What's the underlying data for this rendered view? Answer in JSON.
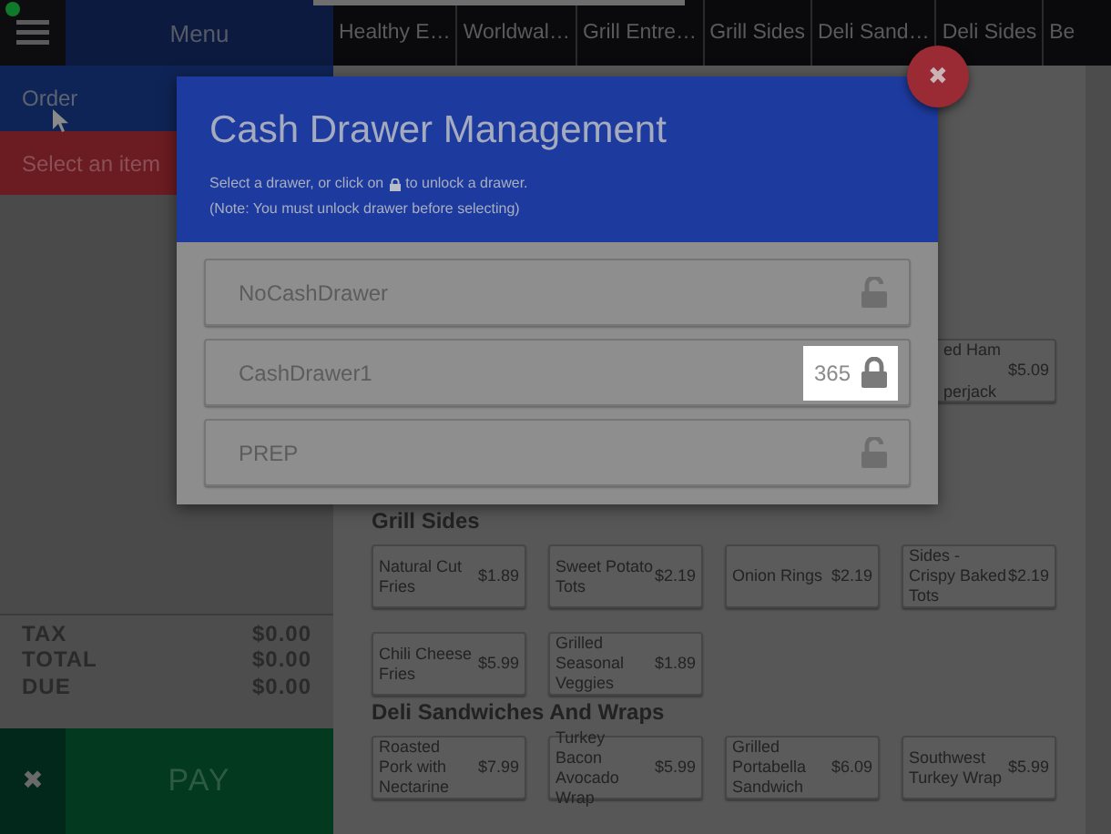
{
  "sidebar": {
    "menu_title": "Menu",
    "order_label": "Order",
    "notice": "Select an item",
    "totals": [
      {
        "label": "TAX",
        "value": "$0.00"
      },
      {
        "label": "TOTAL",
        "value": "$0.00"
      },
      {
        "label": "DUE",
        "value": "$0.00"
      }
    ],
    "pay_label": "PAY",
    "cancel_icon": "✖"
  },
  "tabs": [
    {
      "label": "Healthy E…",
      "selected": false
    },
    {
      "label": "Worldwal…",
      "selected": false
    },
    {
      "label": "Grill Entre…",
      "selected": false
    },
    {
      "label": "Grill Sides",
      "selected": false
    },
    {
      "label": "Deli Sand…",
      "selected": false
    },
    {
      "label": "Deli Sides",
      "selected": false
    },
    {
      "label": "Be",
      "selected": false
    }
  ],
  "partial_item": {
    "lines": [
      "ed Ham",
      "perjack"
    ],
    "price": "$5.09"
  },
  "sections": [
    {
      "title": "Grill Sides",
      "items": [
        {
          "name": "Natural Cut Fries",
          "price": "$1.89"
        },
        {
          "name": "Sweet Potato Tots",
          "price": "$2.19"
        },
        {
          "name": "Onion Rings",
          "price": "$2.19"
        },
        {
          "name": "Sides - Crispy Baked Tots",
          "price": "$2.19"
        },
        {
          "name": "Chili Cheese Fries",
          "price": "$5.99"
        },
        {
          "name": "Grilled Seasonal Veggies",
          "price": "$1.89"
        }
      ]
    },
    {
      "title": "Deli Sandwiches And Wraps",
      "items": [
        {
          "name": "Roasted Pork with Nectarine",
          "price": "$7.99"
        },
        {
          "name": "Turkey Bacon Avocado Wrap",
          "price": "$5.99"
        },
        {
          "name": "Grilled Portabella Sandwich",
          "price": "$6.09"
        },
        {
          "name": "Southwest Turkey Wrap",
          "price": "$5.99"
        }
      ]
    }
  ],
  "dialog": {
    "title": "Cash Drawer Management",
    "hint_before": "Select a drawer, or click on",
    "hint_after": "to unlock a drawer.",
    "note": "(Note: You must unlock drawer before selecting)",
    "close_icon": "✖",
    "drawers": [
      {
        "name": "NoCashDrawer",
        "locked": false
      },
      {
        "name": "CashDrawer1",
        "locked": true,
        "count": "365"
      },
      {
        "name": "PREP",
        "locked": false
      }
    ]
  }
}
